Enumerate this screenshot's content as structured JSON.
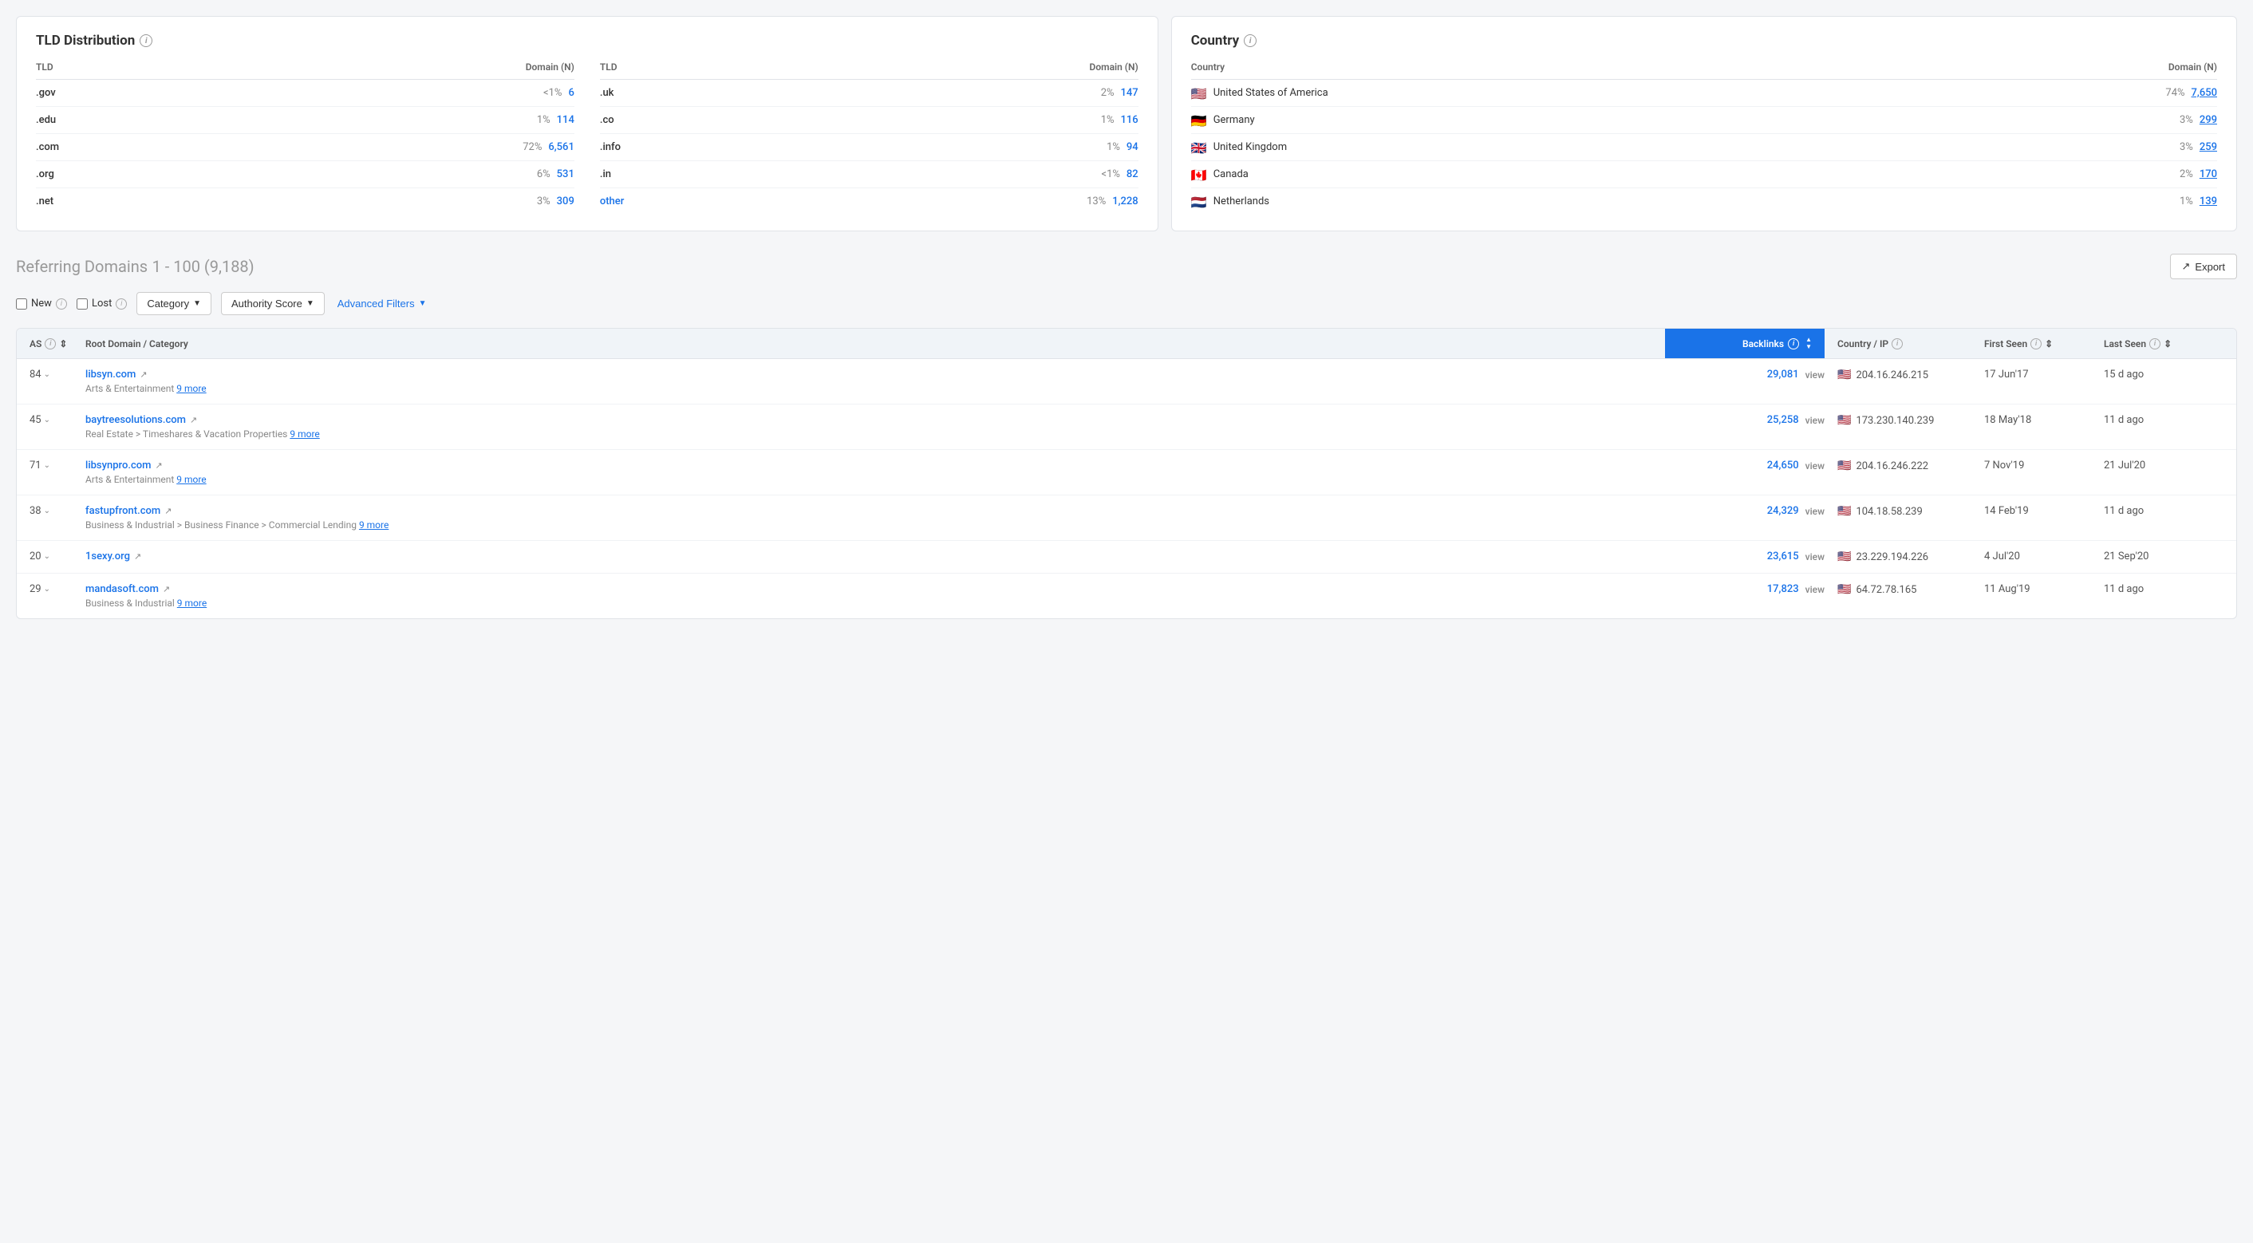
{
  "tld_distribution": {
    "title": "TLD Distribution",
    "left_columns": {
      "header_tld": "TLD",
      "header_domain": "Domain (N)",
      "rows": [
        {
          "tld": ".gov",
          "pct": "<1%",
          "count": "6"
        },
        {
          "tld": ".edu",
          "pct": "1%",
          "count": "114"
        },
        {
          "tld": ".com",
          "pct": "72%",
          "count": "6,561"
        },
        {
          "tld": ".org",
          "pct": "6%",
          "count": "531"
        },
        {
          "tld": ".net",
          "pct": "3%",
          "count": "309"
        }
      ]
    },
    "right_columns": {
      "header_tld": "TLD",
      "header_domain": "Domain (N)",
      "rows": [
        {
          "tld": ".uk",
          "pct": "2%",
          "count": "147"
        },
        {
          "tld": ".co",
          "pct": "1%",
          "count": "116"
        },
        {
          "tld": ".info",
          "pct": "1%",
          "count": "94"
        },
        {
          "tld": ".in",
          "pct": "<1%",
          "count": "82"
        },
        {
          "tld": "other",
          "pct": "13%",
          "count": "1,228",
          "is_link": true
        }
      ]
    }
  },
  "country": {
    "title": "Country",
    "header_country": "Country",
    "header_domain": "Domain (N)",
    "rows": [
      {
        "name": "United States of America",
        "flag": "us",
        "pct": "74%",
        "count": "7,650"
      },
      {
        "name": "Germany",
        "flag": "de",
        "pct": "3%",
        "count": "299"
      },
      {
        "name": "United Kingdom",
        "flag": "gb",
        "pct": "3%",
        "count": "259"
      },
      {
        "name": "Canada",
        "flag": "ca",
        "pct": "2%",
        "count": "170"
      },
      {
        "name": "Netherlands",
        "flag": "nl",
        "pct": "1%",
        "count": "139"
      }
    ]
  },
  "referring_domains": {
    "title": "Referring Domains",
    "range": "1 - 100 (9,188)",
    "export_label": "Export",
    "filters": {
      "new_label": "New",
      "lost_label": "Lost",
      "category_label": "Category",
      "authority_score_label": "Authority Score",
      "advanced_filters_label": "Advanced Filters"
    },
    "table": {
      "col_as": "AS",
      "col_domain": "Root Domain / Category",
      "col_backlinks": "Backlinks",
      "col_country_ip": "Country / IP",
      "col_first_seen": "First Seen",
      "col_last_seen": "Last Seen",
      "rows": [
        {
          "as": "84",
          "domain": "libsyn.com",
          "category": "Arts & Entertainment",
          "more": "9 more",
          "backlinks": "29,081",
          "country_flag": "us",
          "ip": "204.16.246.215",
          "first_seen": "17 Jun'17",
          "last_seen": "15 d ago"
        },
        {
          "as": "45",
          "domain": "baytreesolutions.com",
          "category": "Real Estate > Timeshares & Vacation Properties",
          "more": "9 more",
          "backlinks": "25,258",
          "country_flag": "us",
          "ip": "173.230.140.239",
          "first_seen": "18 May'18",
          "last_seen": "11 d ago"
        },
        {
          "as": "71",
          "domain": "libsynpro.com",
          "category": "Arts & Entertainment",
          "more": "9 more",
          "backlinks": "24,650",
          "country_flag": "us",
          "ip": "204.16.246.222",
          "first_seen": "7 Nov'19",
          "last_seen": "21 Jul'20"
        },
        {
          "as": "38",
          "domain": "fastupfront.com",
          "category": "Business & Industrial > Business Finance > Commercial Lending",
          "more": "9 more",
          "backlinks": "24,329",
          "country_flag": "us",
          "ip": "104.18.58.239",
          "first_seen": "14 Feb'19",
          "last_seen": "11 d ago"
        },
        {
          "as": "20",
          "domain": "1sexy.org",
          "category": "",
          "more": "",
          "backlinks": "23,615",
          "country_flag": "us",
          "ip": "23.229.194.226",
          "first_seen": "4 Jul'20",
          "last_seen": "21 Sep'20"
        },
        {
          "as": "29",
          "domain": "mandasoft.com",
          "category": "Business & Industrial",
          "more": "9 more",
          "backlinks": "17,823",
          "country_flag": "us",
          "ip": "64.72.78.165",
          "first_seen": "11 Aug'19",
          "last_seen": "11 d ago"
        }
      ]
    }
  },
  "colors": {
    "blue": "#1a73e8",
    "header_bg": "#f0f4f8",
    "border": "#e0e3e8"
  }
}
